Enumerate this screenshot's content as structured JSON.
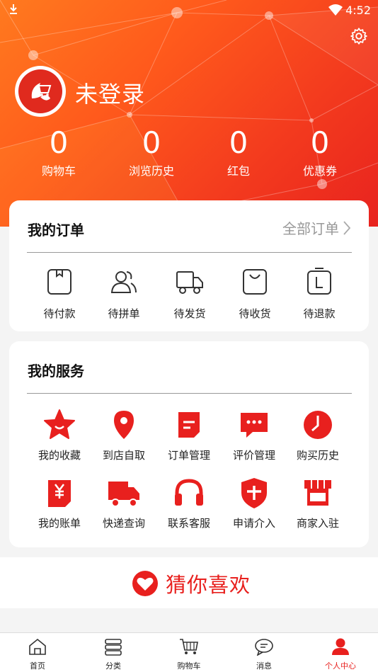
{
  "status_bar": {
    "time": "4:52"
  },
  "profile": {
    "login_text": "未登录"
  },
  "stats": [
    {
      "value": "0",
      "label": "购物车"
    },
    {
      "value": "0",
      "label": "浏览历史"
    },
    {
      "value": "0",
      "label": "红包"
    },
    {
      "value": "0",
      "label": "优惠券"
    }
  ],
  "orders": {
    "title": "我的订单",
    "all_link": "全部订单",
    "items": [
      {
        "label": "待付款",
        "icon": "wallet-icon"
      },
      {
        "label": "待拼单",
        "icon": "group-icon"
      },
      {
        "label": "待发货",
        "icon": "truck-icon"
      },
      {
        "label": "待收货",
        "icon": "bag-icon"
      },
      {
        "label": "待退款",
        "icon": "refund-icon"
      }
    ]
  },
  "services": {
    "title": "我的服务",
    "items": [
      {
        "label": "我的收藏",
        "icon": "star-icon"
      },
      {
        "label": "到店自取",
        "icon": "location-icon"
      },
      {
        "label": "订单管理",
        "icon": "note-icon"
      },
      {
        "label": "评价管理",
        "icon": "comment-icon"
      },
      {
        "label": "购买历史",
        "icon": "clock-icon"
      },
      {
        "label": "我的账单",
        "icon": "yuan-icon"
      },
      {
        "label": "快递查询",
        "icon": "delivery-truck-icon"
      },
      {
        "label": "联系客服",
        "icon": "headset-icon"
      },
      {
        "label": "申请介入",
        "icon": "shield-plus-icon"
      },
      {
        "label": "商家入驻",
        "icon": "store-icon"
      }
    ]
  },
  "guess": {
    "title": "猜你喜欢"
  },
  "tabbar": [
    {
      "label": "首页",
      "icon": "home-icon"
    },
    {
      "label": "分类",
      "icon": "category-icon"
    },
    {
      "label": "购物车",
      "icon": "cart-icon"
    },
    {
      "label": "消息",
      "icon": "message-icon"
    },
    {
      "label": "个人中心",
      "icon": "user-icon",
      "active": true
    }
  ],
  "colors": {
    "accent": "#e8201e",
    "header_start": "#ff7a1f",
    "header_end": "#e8231f"
  }
}
